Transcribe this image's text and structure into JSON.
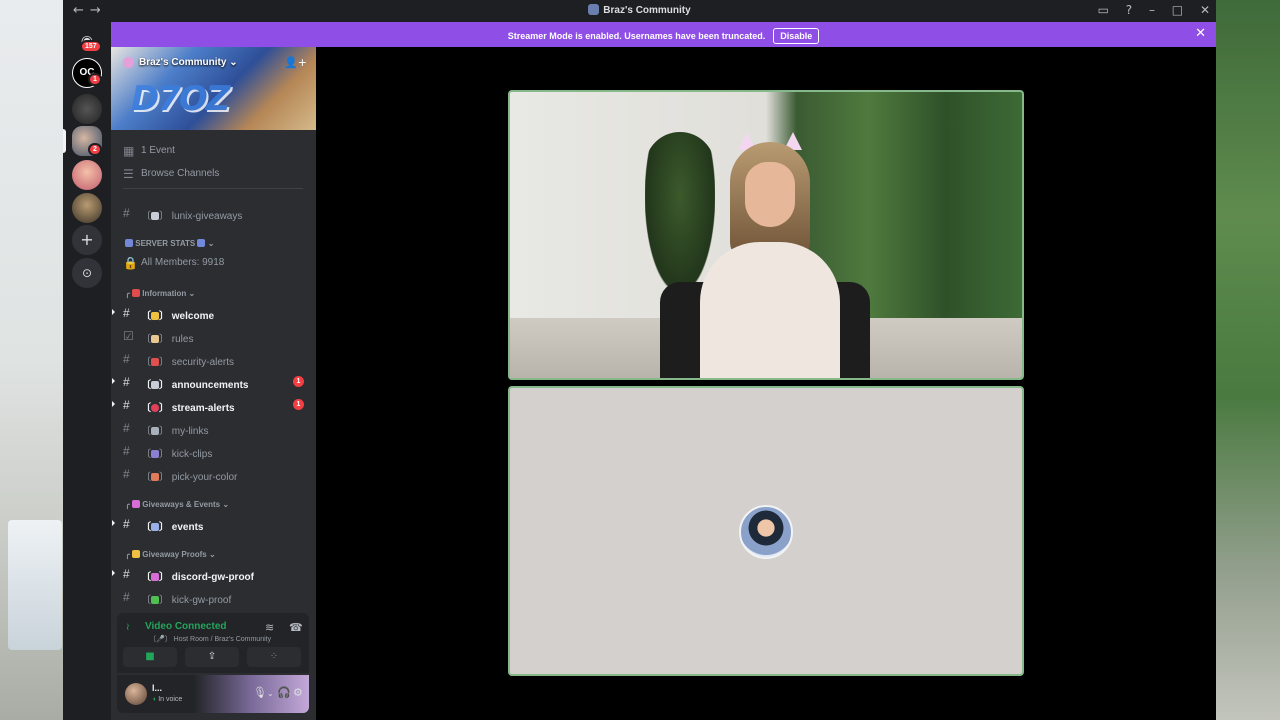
{
  "window": {
    "title": "Braz's Community",
    "nav_back": "←",
    "nav_forward": "→"
  },
  "banner": {
    "text": "Streamer Mode is enabled. Usernames have been truncated.",
    "button": "Disable",
    "close": "✕"
  },
  "rail": {
    "home_badge": "157",
    "server2_badge": "1",
    "server4_badge": "2",
    "add_icon": "+",
    "explore_icon": "⊙"
  },
  "server": {
    "name": "Braz's Community",
    "chevron": "⌄",
    "invite_icon": "👤+",
    "art_text": "D7OZ"
  },
  "sidebar": {
    "events": "1 Event",
    "browse": "Browse Channels",
    "giveaways_channel": "lunix-giveaways",
    "server_stats_category": "SERVER STATS",
    "members": "All Members: 9918",
    "information_category": "Information",
    "giveaways_category": "Giveaways & Events",
    "proofs_category": "Giveaway Proofs",
    "channels": [
      {
        "name": "welcome",
        "unread": true
      },
      {
        "name": "rules",
        "unread": false
      },
      {
        "name": "security-alerts",
        "unread": false
      },
      {
        "name": "announcements",
        "unread": true,
        "badge": "1"
      },
      {
        "name": "stream-alerts",
        "unread": true,
        "badge": "1"
      },
      {
        "name": "my-links",
        "unread": false
      },
      {
        "name": "kick-clips",
        "unread": false
      },
      {
        "name": "pick-your-color",
        "unread": false
      }
    ],
    "events_channel": "events",
    "discord_proof_channel": "discord-gw-proof",
    "kick_proof_channel": "kick-gw-proof"
  },
  "voice": {
    "status": "Video Connected",
    "location": "Host Room / Braz's Community",
    "camera_icon": "■",
    "share_icon": "⇪",
    "activity_icon": "⁘",
    "disconnect_icon": "☎",
    "noise_icon": "≋"
  },
  "user": {
    "name": "l...",
    "status": "In voice",
    "mic_icon": "🎙",
    "headset_icon": "🎧",
    "settings_icon": "⚙"
  },
  "colors": {
    "accent": "#8f4ee6",
    "online": "#23a55a",
    "mention": "#f23f43",
    "tile_border": "#86b88a"
  }
}
